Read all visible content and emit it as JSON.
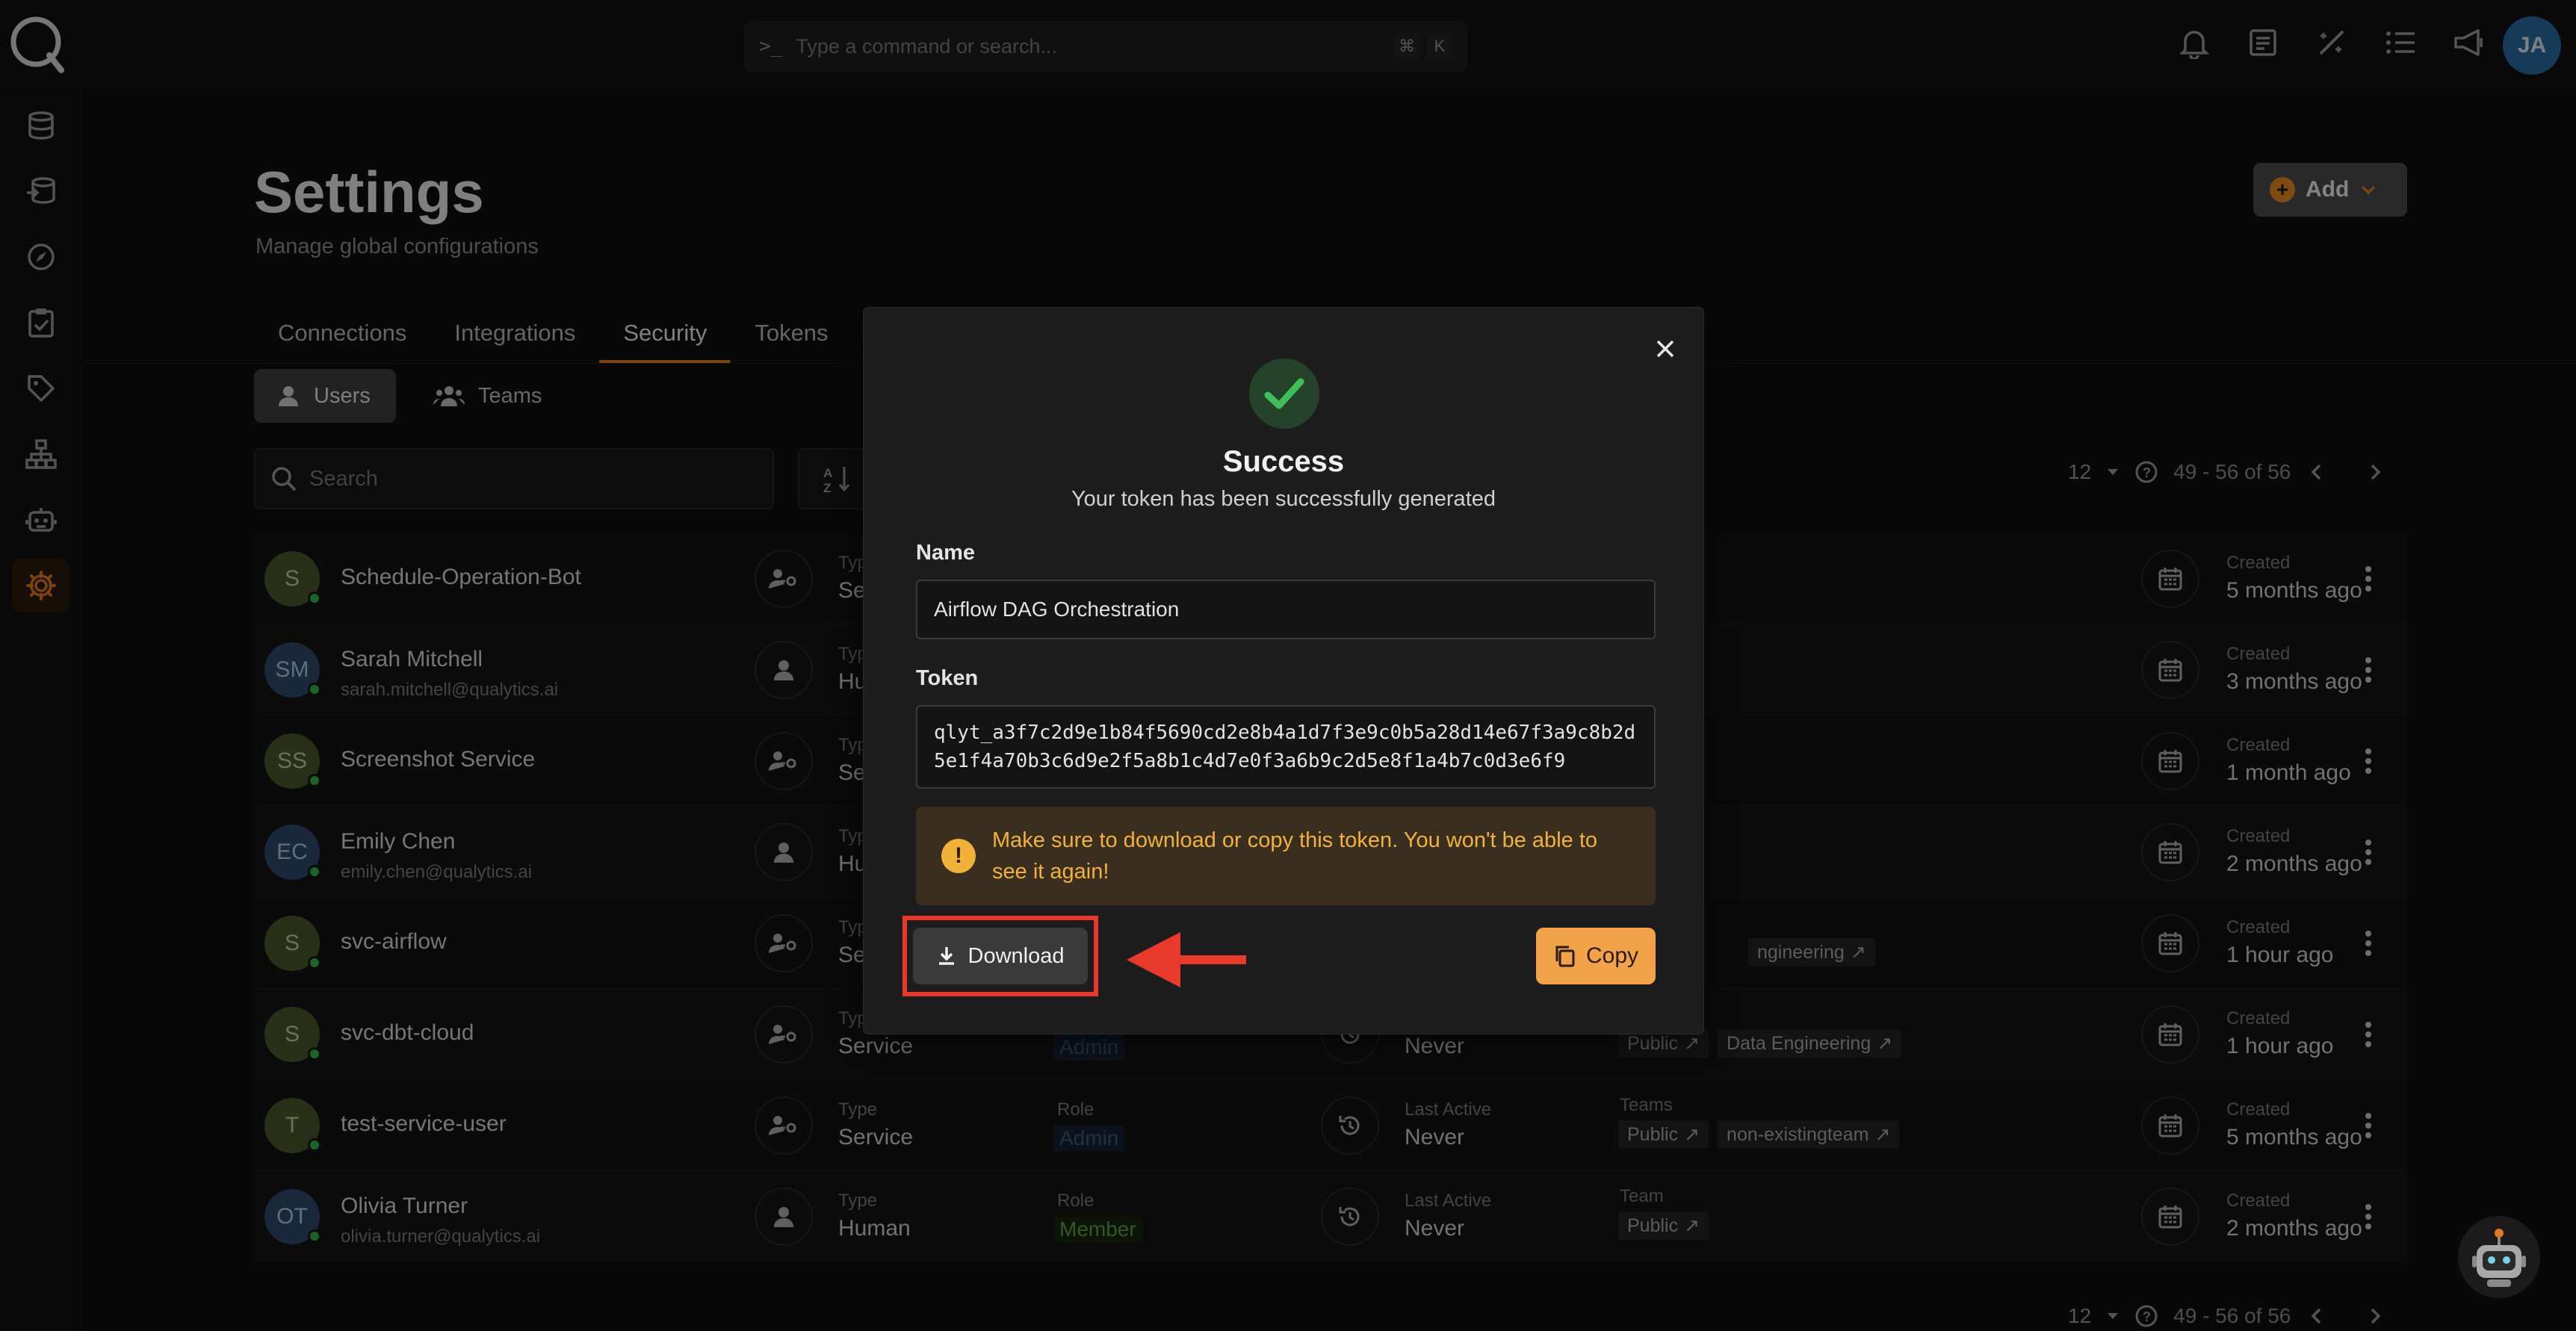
{
  "topbar": {
    "command_placeholder": "Type a command or search...",
    "shortcut_keys": [
      "⌘",
      "K"
    ],
    "avatar_initials": "JA"
  },
  "page": {
    "title": "Settings",
    "subtitle": "Manage global configurations",
    "add_label": "Add"
  },
  "tabs": [
    {
      "label": "Connections"
    },
    {
      "label": "Integrations"
    },
    {
      "label": "Security"
    },
    {
      "label": "Tokens"
    }
  ],
  "active_tab": "Security",
  "subtabs": {
    "users": "Users",
    "teams": "Teams"
  },
  "search": {
    "placeholder": "Search"
  },
  "pagination": {
    "page_size": "12",
    "range": "49 - 56 of 56"
  },
  "users": [
    {
      "initials": "S",
      "name": "Schedule-Operation-Bot",
      "email": "",
      "type_label": "Type",
      "type": "Service",
      "created_label": "Created",
      "created": "5 months ago"
    },
    {
      "initials": "SM",
      "name": "Sarah Mitchell",
      "email": "sarah.mitchell@qualytics.ai",
      "type_label": "Type",
      "type": "Human",
      "created_label": "Created",
      "created": "3 months ago"
    },
    {
      "initials": "SS",
      "name": "Screenshot Service",
      "email": "",
      "type_label": "Type",
      "type": "Service",
      "created_label": "Created",
      "created": "1 month ago"
    },
    {
      "initials": "EC",
      "name": "Emily Chen",
      "email": "emily.chen@qualytics.ai",
      "type_label": "Type",
      "type": "Human",
      "created_label": "Created",
      "created": "2 months ago"
    },
    {
      "initials": "S",
      "name": "svc-airflow",
      "email": "",
      "type_label": "Type",
      "type": "Service",
      "tag": "ngineering",
      "created_label": "Created",
      "created": "1 hour ago"
    },
    {
      "initials": "S",
      "name": "svc-dbt-cloud",
      "email": "",
      "type_label": "Type",
      "type": "Service",
      "role": "Admin",
      "last_active": "Never",
      "tags": [
        "Public",
        "Data Engineering"
      ],
      "created_label": "Created",
      "created": "1 hour ago"
    },
    {
      "initials": "T",
      "name": "test-service-user",
      "email": "",
      "type_label": "Type",
      "type": "Service",
      "role_label": "Role",
      "role": "Admin",
      "last_active_label": "Last Active",
      "last_active": "Never",
      "teams_label": "Teams",
      "tags": [
        "Public",
        "non-existingteam"
      ],
      "created_label": "Created",
      "created": "5 months ago"
    },
    {
      "initials": "OT",
      "name": "Olivia Turner",
      "email": "olivia.turner@qualytics.ai",
      "type_label": "Type",
      "type": "Human",
      "role_label": "Role",
      "role": "Member",
      "last_active_label": "Last Active",
      "last_active": "Never",
      "teams_label": "Team",
      "tags": [
        "Public"
      ],
      "created_label": "Created",
      "created": "2 months ago"
    }
  ],
  "modal": {
    "title": "Success",
    "subtitle": "Your token has been successfully generated",
    "name_label": "Name",
    "name_value": "Airflow DAG Orchestration",
    "token_label": "Token",
    "token_value": "qlyt_a3f7c2d9e1b84f5690cd2e8b4a1d7f3e9c0b5a28d14e67f3a9c8b2d5e1f4a70b3c6d9e2f5a8b1c4d7e0f3a6b9c2d5e8f1a4b7c0d3e6f9",
    "warning": "Make sure to download or copy this token. You won't be able to see it again!",
    "download_label": "Download",
    "copy_label": "Copy"
  },
  "colors": {
    "accent": "#e07a1a",
    "success": "#3fbf5a",
    "warning": "#f2b23a",
    "highlight": "#e8392a"
  }
}
